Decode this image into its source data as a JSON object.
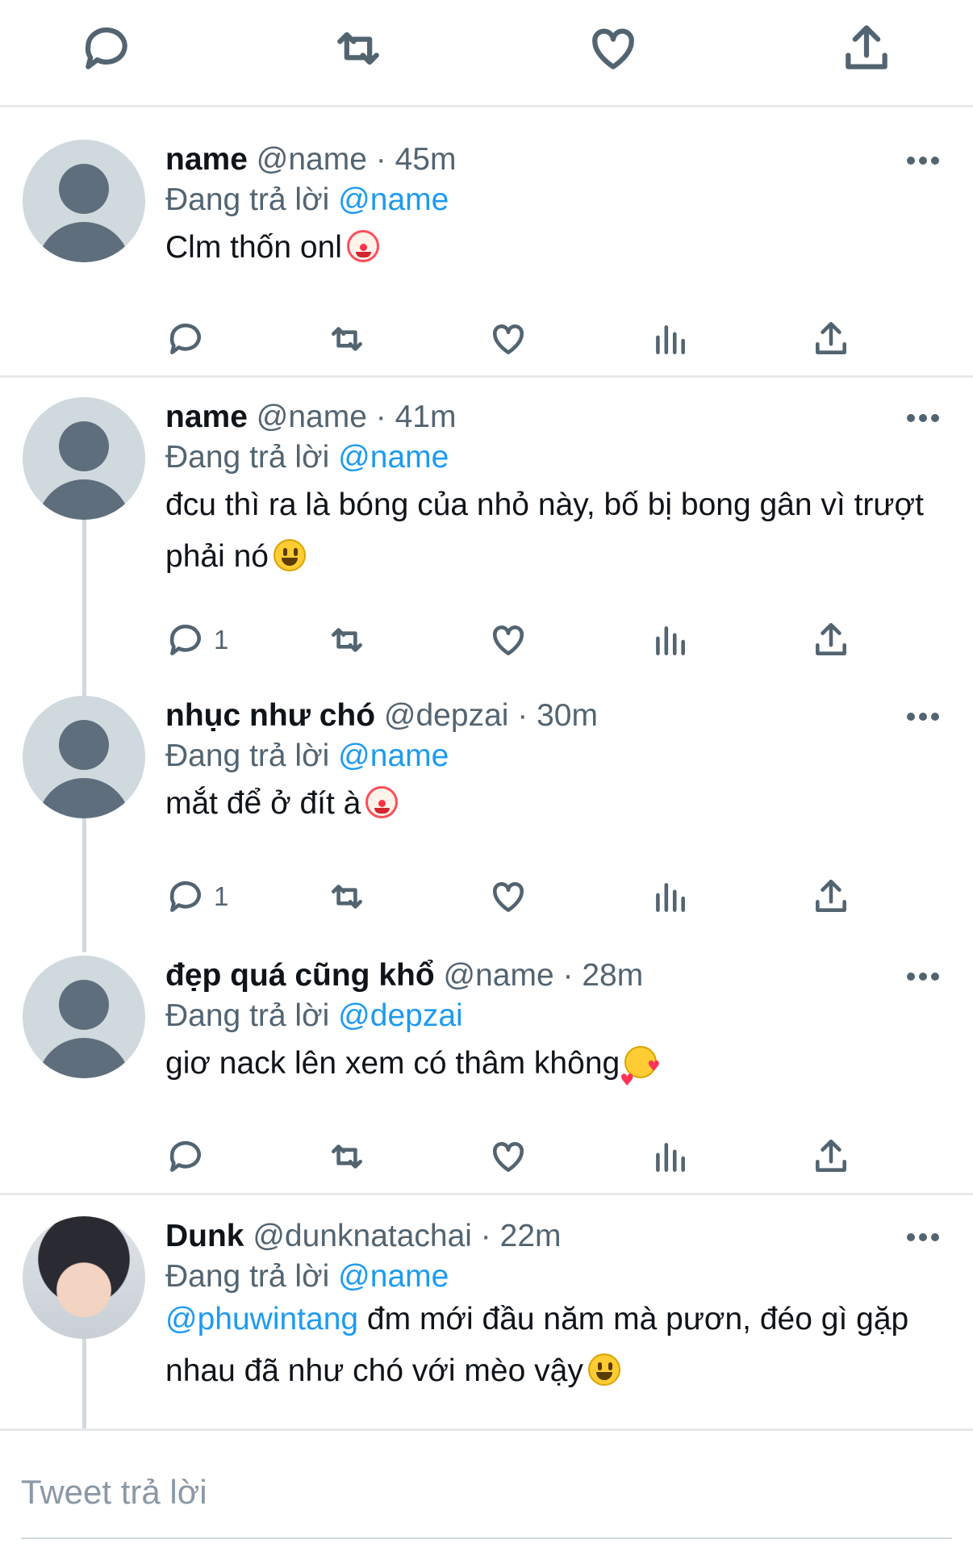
{
  "composer": {
    "placeholder": "Tweet trả lời"
  },
  "tweets": [
    {
      "name": "name",
      "handle": "@name",
      "time": "45m",
      "reply_prefix": "Đang trả lời",
      "reply_to": "@name",
      "text": "Clm thốn onl",
      "emoji": "clown-emoji",
      "reply_count": ""
    },
    {
      "name": "name",
      "handle": "@name",
      "time": "41m",
      "reply_prefix": "Đang trả lời",
      "reply_to": "@name",
      "text": "đcu thì ra là bóng của nhỏ này, bố bị bong gân vì trượt phải nó",
      "emoji": "smile-emoji",
      "reply_count": "1"
    },
    {
      "name": "nhục như chó",
      "handle": "@depzai",
      "time": "30m",
      "reply_prefix": "Đang trả lời",
      "reply_to": "@name",
      "text": "mắt để ở đít à",
      "emoji": "clown-emoji",
      "reply_count": "1"
    },
    {
      "name": "đẹp quá cũng khổ",
      "handle": "@name",
      "time": "28m",
      "reply_prefix": "Đang trả lời",
      "reply_to": "@depzai",
      "text": "giơ nack lên xem có thâm không",
      "emoji": "smiling-face-with-hearts-emoji",
      "reply_count": ""
    },
    {
      "name": "Dunk",
      "handle": "@dunknatachai",
      "time": "22m",
      "reply_prefix": "Đang trả lời",
      "reply_to": "@name",
      "text_mention": "@phuwintang",
      "text": " đm mới đầu năm mà pươn, đéo gì gặp nhau đã như chó với mèo vậy",
      "emoji": "smile-emoji"
    }
  ],
  "colors": {
    "accent": "#1d9bf0",
    "muted": "#536471",
    "divider": "#e6e9ec"
  }
}
